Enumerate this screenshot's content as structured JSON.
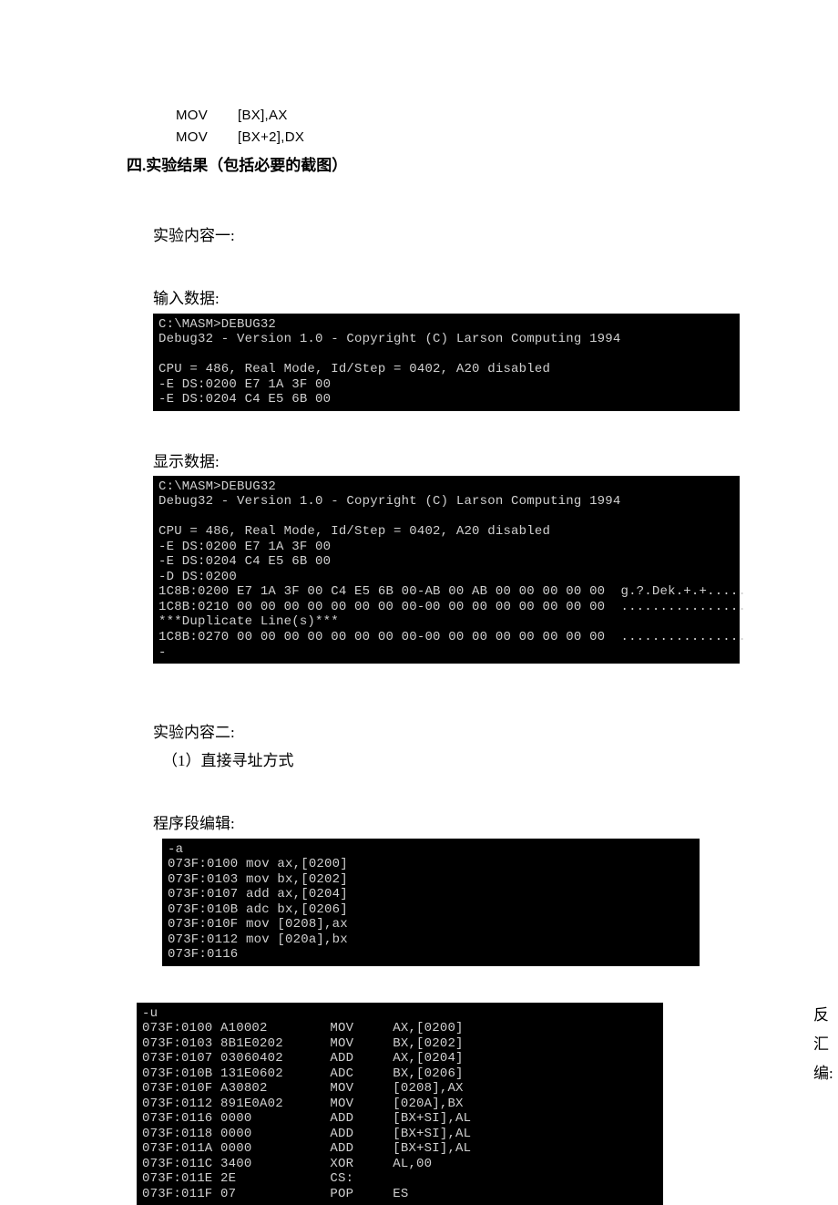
{
  "asm": {
    "line1_op": "MOV",
    "line1_args": "[BX],AX",
    "line2_op": "MOV",
    "line2_args": "[BX+2],DX"
  },
  "headings": {
    "section4": "四.实验结果（包括必要的截图）",
    "exp1": "实验内容一:",
    "input_data": "输入数据:",
    "display_data": "显示数据:",
    "exp2": "实验内容二:",
    "mode1": "（1）直接寻址方式",
    "prog_edit": "程序段编辑:",
    "disasm": "反汇编:"
  },
  "terminal1": "C:\\MASM>DEBUG32\nDebug32 - Version 1.0 - Copyright (C) Larson Computing 1994\n\nCPU = 486, Real Mode, Id/Step = 0402, A20 disabled\n-E DS:0200 E7 1A 3F 00\n-E DS:0204 C4 E5 6B 00",
  "terminal2": "C:\\MASM>DEBUG32\nDebug32 - Version 1.0 - Copyright (C) Larson Computing 1994\n\nCPU = 486, Real Mode, Id/Step = 0402, A20 disabled\n-E DS:0200 E7 1A 3F 00\n-E DS:0204 C4 E5 6B 00\n-D DS:0200\n1C8B:0200 E7 1A 3F 00 C4 E5 6B 00-AB 00 AB 00 00 00 00 00  g.?.Dek.+.+.....\n1C8B:0210 00 00 00 00 00 00 00 00-00 00 00 00 00 00 00 00  ................\n***Duplicate Line(s)***\n1C8B:0270 00 00 00 00 00 00 00 00-00 00 00 00 00 00 00 00  ................\n-",
  "terminal3": "-a\n073F:0100 mov ax,[0200]\n073F:0103 mov bx,[0202]\n073F:0107 add ax,[0204]\n073F:010B adc bx,[0206]\n073F:010F mov [0208],ax\n073F:0112 mov [020a],bx\n073F:0116",
  "terminal4": "-u\n073F:0100 A10002        MOV     AX,[0200]\n073F:0103 8B1E0202      MOV     BX,[0202]\n073F:0107 03060402      ADD     AX,[0204]\n073F:010B 131E0602      ADC     BX,[0206]\n073F:010F A30802        MOV     [0208],AX\n073F:0112 891E0A02      MOV     [020A],BX\n073F:0116 0000          ADD     [BX+SI],AL\n073F:0118 0000          ADD     [BX+SI],AL\n073F:011A 0000          ADD     [BX+SI],AL\n073F:011C 3400          XOR     AL,00\n073F:011E 2E            CS:\n073F:011F 07            POP     ES"
}
